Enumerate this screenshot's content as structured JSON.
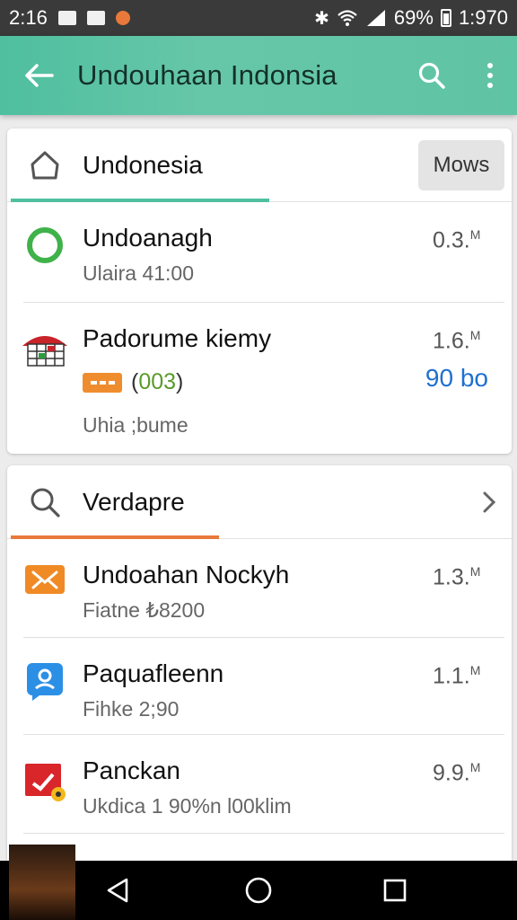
{
  "status_bar": {
    "time": "2:16",
    "battery": "69%",
    "clock": "1:970"
  },
  "app_bar": {
    "title": "Undouhaan Indonsia"
  },
  "card1": {
    "title": "Undonesia",
    "button": "Mows",
    "items": [
      {
        "title": "Undoanagh",
        "subtitle": "Ulaira 41:00",
        "size": "0.3.",
        "unit": "M"
      },
      {
        "title": "Padorume kiemy",
        "code": "003",
        "price": "90 bo",
        "subtitle": "Uhia ;bume",
        "size": "1.6.",
        "unit": "M"
      }
    ]
  },
  "card2": {
    "title": "Verdapre",
    "items": [
      {
        "title": "Undoahan Nockyh",
        "subtitle": "Fiatne ₺8200",
        "size": "1.3.",
        "unit": "M"
      },
      {
        "title": "Paquafleenn",
        "subtitle": "Fihke 2;90",
        "size": "1.1.",
        "unit": "M"
      },
      {
        "title": "Panckan",
        "subtitle": "Ukdica 1 90%n l00klim",
        "size": "9.9.",
        "unit": "M"
      }
    ]
  },
  "colors": {
    "accent_green": "#4fbf9f",
    "accent_orange": "#e8793a",
    "link_blue": "#1f6fd0"
  }
}
